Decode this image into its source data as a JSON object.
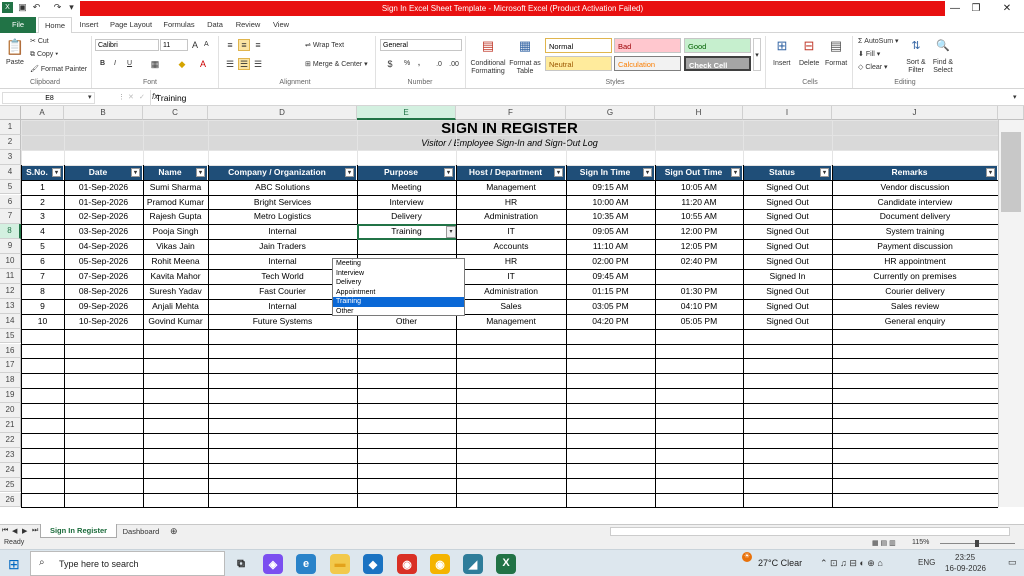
{
  "window": {
    "title": "Sign In Excel Sheet Template - Microsoft Excel (Product Activation Failed)"
  },
  "tabs": [
    "File",
    "Home",
    "Insert",
    "Page Layout",
    "Formulas",
    "Data",
    "Review",
    "View"
  ],
  "ribbon": {
    "clipboard": {
      "paste": "Paste",
      "cut": "Cut",
      "copy": "Copy",
      "format_painter": "Format Painter",
      "group": "Clipboard"
    },
    "font": {
      "name": "Calibri",
      "size": "11",
      "group": "Font",
      "bold": "B",
      "italic": "I",
      "underline": "U",
      "grow": "A",
      "shrink": "A"
    },
    "alignment": {
      "wrap": "Wrap Text",
      "merge": "Merge & Center",
      "group": "Alignment"
    },
    "number": {
      "format": "General",
      "percent": "%",
      "comma": ",",
      "group": "Number"
    },
    "styles": {
      "cond": "Conditional Formatting",
      "table": "Format as Table",
      "normal": "Normal",
      "bad": "Bad",
      "good": "Good",
      "neutral": "Neutral",
      "calculation": "Calculation",
      "check": "Check Cell",
      "group": "Styles",
      "cond_line1": "Conditional",
      "cond_line2": "Formatting",
      "table_line1": "Format as",
      "table_line2": "Table"
    },
    "cells": {
      "insert": "Insert",
      "delete": "Delete",
      "format": "Format",
      "group": "Cells"
    },
    "editing": {
      "autosum": "AutoSum",
      "fill": "Fill",
      "clear": "Clear",
      "sort1": "Sort &",
      "sort2": "Filter",
      "find1": "Find &",
      "find2": "Select",
      "group": "Editing"
    }
  },
  "formula_bar": {
    "name_box": "E8",
    "fx": "fx",
    "value": "Training"
  },
  "columns": [
    "A",
    "B",
    "C",
    "D",
    "E",
    "F",
    "G",
    "H",
    "I",
    "J"
  ],
  "sheet": {
    "title": "SIGN IN REGISTER",
    "subtitle": "Visitor / Employee Sign-In and Sign-Out Log",
    "headers": [
      "S.No.",
      "Date",
      "Name",
      "Company / Organization",
      "Purpose",
      "Host / Department",
      "Sign In Time",
      "Sign Out Time",
      "Status",
      "Remarks"
    ],
    "rows": [
      [
        "1",
        "01-Sep-2026",
        "Sumi Sharma",
        "ABC Solutions",
        "Meeting",
        "Management",
        "09:15 AM",
        "10:05 AM",
        "Signed Out",
        "Vendor discussion"
      ],
      [
        "2",
        "01-Sep-2026",
        "Pramod Kumar",
        "Bright Services",
        "Interview",
        "HR",
        "10:00 AM",
        "11:20 AM",
        "Signed Out",
        "Candidate interview"
      ],
      [
        "3",
        "02-Sep-2026",
        "Rajesh Gupta",
        "Metro Logistics",
        "Delivery",
        "Administration",
        "10:35 AM",
        "10:55 AM",
        "Signed Out",
        "Document delivery"
      ],
      [
        "4",
        "03-Sep-2026",
        "Pooja Singh",
        "Internal",
        "Training",
        "IT",
        "09:05 AM",
        "12:00 PM",
        "Signed Out",
        "System training"
      ],
      [
        "5",
        "04-Sep-2026",
        "Vikas Jain",
        "Jain Traders",
        "",
        "Accounts",
        "11:10 AM",
        "12:05 PM",
        "Signed Out",
        "Payment discussion"
      ],
      [
        "6",
        "05-Sep-2026",
        "Rohit Meena",
        "Internal",
        "",
        "HR",
        "02:00 PM",
        "02:40 PM",
        "Signed Out",
        "HR appointment"
      ],
      [
        "7",
        "07-Sep-2026",
        "Kavita Mahor",
        "Tech World",
        "",
        "IT",
        "09:45 AM",
        "",
        "Signed In",
        "Currently on premises"
      ],
      [
        "8",
        "08-Sep-2026",
        "Suresh Yadav",
        "Fast Courier",
        "",
        "Administration",
        "01:15 PM",
        "01:30 PM",
        "Signed Out",
        "Courier delivery"
      ],
      [
        "9",
        "09-Sep-2026",
        "Anjali Mehta",
        "Internal",
        "Meeting",
        "Sales",
        "03:05 PM",
        "04:10 PM",
        "Signed Out",
        "Sales review"
      ],
      [
        "10",
        "10-Sep-2026",
        "Govind Kumar",
        "Future Systems",
        "Other",
        "Management",
        "04:20 PM",
        "05:05 PM",
        "Signed Out",
        "General enquiry"
      ]
    ]
  },
  "row_numbers": [
    "1",
    "2",
    "3",
    "4",
    "5",
    "6",
    "7",
    "8",
    "9",
    "10",
    "11",
    "12",
    "13",
    "14",
    "15",
    "16",
    "17",
    "18",
    "19",
    "20",
    "21",
    "22",
    "23",
    "24",
    "25",
    "26"
  ],
  "dropdown": {
    "options": [
      "Meeting",
      "Interview",
      "Delivery",
      "Appointment",
      "Training",
      "Other"
    ],
    "selected": "Training"
  },
  "sheet_tabs": {
    "active": "Sign In Register",
    "other": "Dashboard"
  },
  "status": {
    "ready": "Ready",
    "zoom": "115%"
  },
  "taskbar": {
    "search": "Type here to search",
    "weather": "27°C  Clear",
    "lang": "ENG",
    "time": "23:25",
    "date": "16-09-2026"
  },
  "colors": {
    "header_bg": "#1f4e78",
    "excel_green": "#217346",
    "title_red": "#e81010",
    "selected": "#0a68d6"
  }
}
